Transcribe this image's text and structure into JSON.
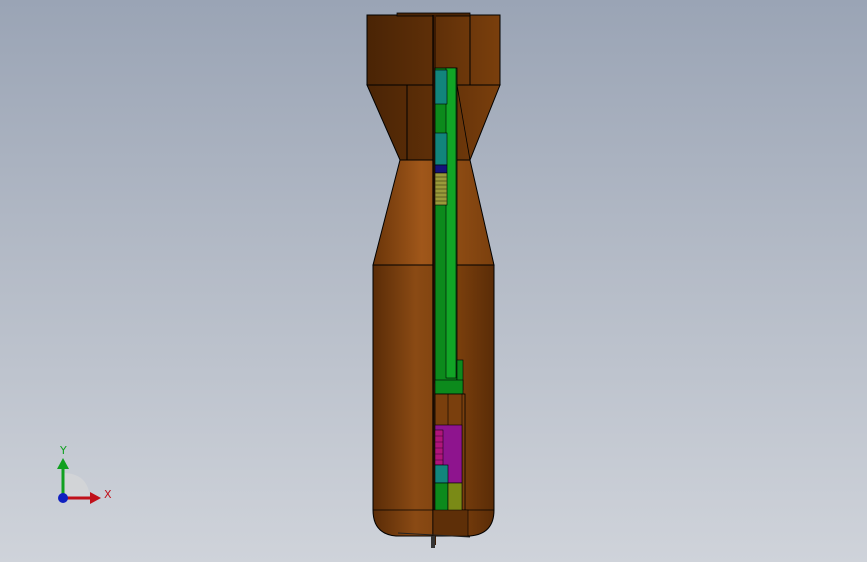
{
  "viewport": {
    "background_top": "#9aa4b5",
    "background_bottom": "#cfd3da"
  },
  "model": {
    "body_color": "#7a3f0d",
    "body_shadow_color": "#4a2405",
    "body_highlight_color": "#a0571a",
    "inner_green": "#0c8a1c",
    "inner_teal": "#12857c",
    "inner_blue": "#14137a",
    "inner_yellow": "#9a9a3a",
    "inner_magenta": "#8e148e",
    "inner_olive": "#7a8a16"
  },
  "triad": {
    "x_label": "X",
    "y_label": "Y",
    "x_color": "#c0101a",
    "y_color": "#10a020",
    "z_color": "#1020c0"
  }
}
